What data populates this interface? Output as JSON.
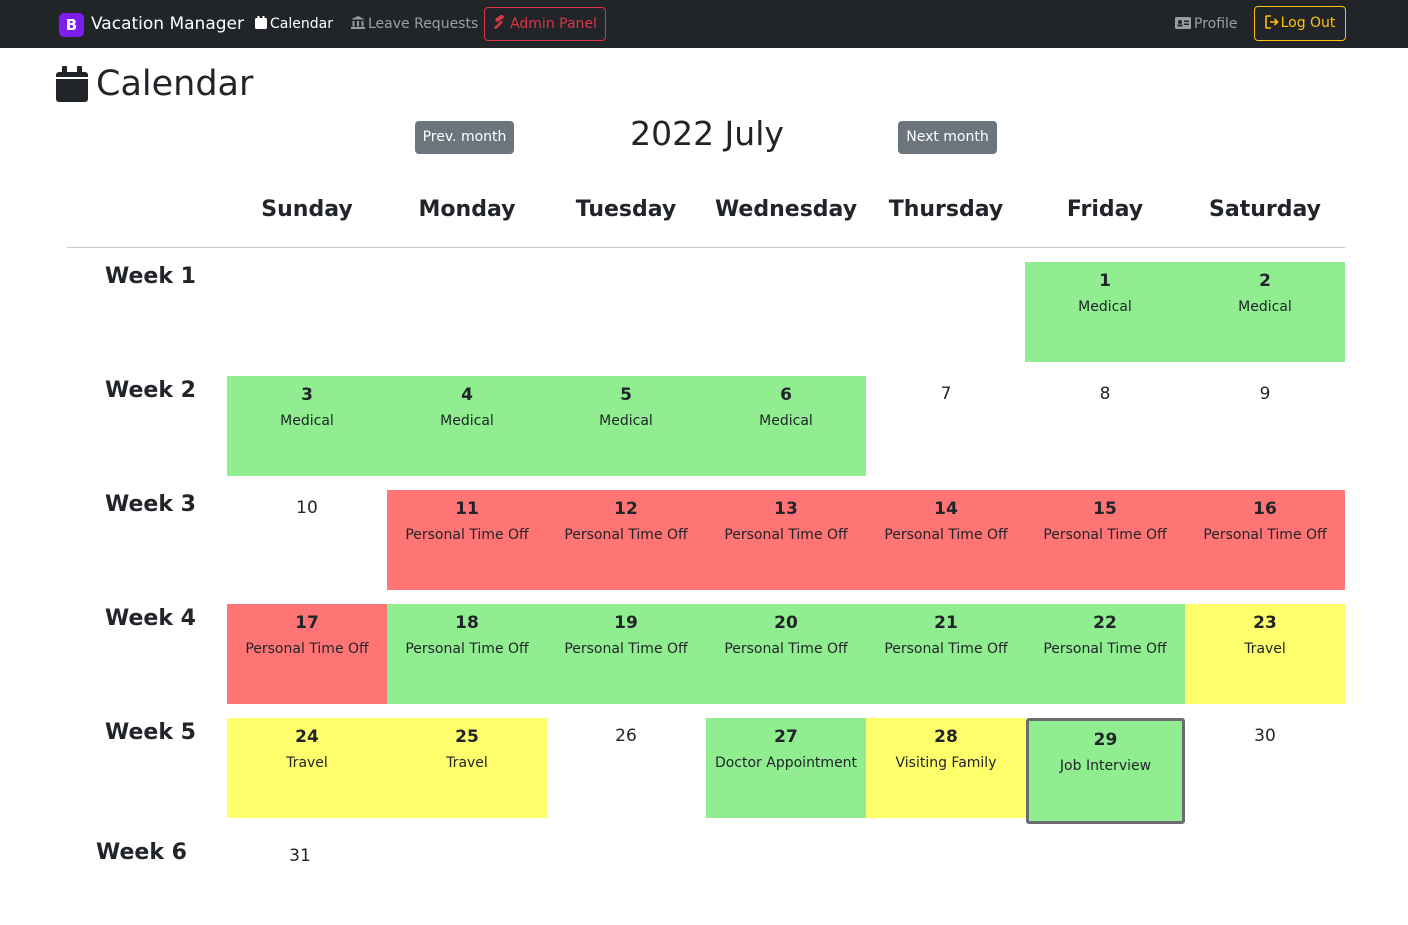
{
  "navbar": {
    "brand_logo": "B",
    "brand": "Vacation Manager",
    "calendar": "Calendar",
    "leave_requests": "Leave Requests",
    "admin_panel": "Admin Panel",
    "profile": "Profile",
    "logout": "Log Out"
  },
  "page": {
    "title": "Calendar"
  },
  "nav": {
    "prev": "Prev. month",
    "next": "Next month",
    "month_title": "2022 July"
  },
  "weekdays": [
    "Sunday",
    "Monday",
    "Tuesday",
    "Wednesday",
    "Thursday",
    "Friday",
    "Saturday"
  ],
  "weeks": [
    "Week 1",
    "Week 2",
    "Week 3",
    "Week 4",
    "Week 5",
    "Week 6"
  ],
  "colors": {
    "green": "#90ee90",
    "red": "#ff7474",
    "yellow": "#ffff6b"
  },
  "days": [
    {
      "day": "1",
      "reason": "Medical",
      "status": "green"
    },
    {
      "day": "2",
      "reason": "Medical",
      "status": "green"
    },
    {
      "day": "3",
      "reason": "Medical",
      "status": "green"
    },
    {
      "day": "4",
      "reason": "Medical",
      "status": "green"
    },
    {
      "day": "5",
      "reason": "Medical",
      "status": "green"
    },
    {
      "day": "6",
      "reason": "Medical",
      "status": "green"
    },
    {
      "day": "7",
      "reason": "",
      "status": "none"
    },
    {
      "day": "8",
      "reason": "",
      "status": "none"
    },
    {
      "day": "9",
      "reason": "",
      "status": "none"
    },
    {
      "day": "10",
      "reason": "",
      "status": "none"
    },
    {
      "day": "11",
      "reason": "Personal Time Off",
      "status": "red"
    },
    {
      "day": "12",
      "reason": "Personal Time Off",
      "status": "red"
    },
    {
      "day": "13",
      "reason": "Personal Time Off",
      "status": "red"
    },
    {
      "day": "14",
      "reason": "Personal Time Off",
      "status": "red"
    },
    {
      "day": "15",
      "reason": "Personal Time Off",
      "status": "red"
    },
    {
      "day": "16",
      "reason": "Personal Time Off",
      "status": "red"
    },
    {
      "day": "17",
      "reason": "Personal Time Off",
      "status": "red"
    },
    {
      "day": "18",
      "reason": "Personal Time Off",
      "status": "green"
    },
    {
      "day": "19",
      "reason": "Personal Time Off",
      "status": "green"
    },
    {
      "day": "20",
      "reason": "Personal Time Off",
      "status": "green"
    },
    {
      "day": "21",
      "reason": "Personal Time Off",
      "status": "green"
    },
    {
      "day": "22",
      "reason": "Personal Time Off",
      "status": "green"
    },
    {
      "day": "23",
      "reason": "Travel",
      "status": "yellow"
    },
    {
      "day": "24",
      "reason": "Travel",
      "status": "yellow"
    },
    {
      "day": "25",
      "reason": "Travel",
      "status": "yellow"
    },
    {
      "day": "26",
      "reason": "",
      "status": "none"
    },
    {
      "day": "27",
      "reason": "Doctor Appointment",
      "status": "green"
    },
    {
      "day": "28",
      "reason": "Visiting Family",
      "status": "yellow"
    },
    {
      "day": "29",
      "reason": "Job Interview",
      "status": "green",
      "selected": true
    },
    {
      "day": "30",
      "reason": "",
      "status": "none"
    },
    {
      "day": "31",
      "reason": "",
      "status": "none"
    }
  ]
}
